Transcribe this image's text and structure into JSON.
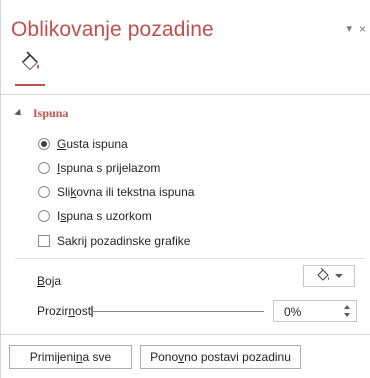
{
  "pane": {
    "title": "Oblikovanje pozadine",
    "dropdown_glyph": "▾",
    "close_glyph": "×",
    "tab_icon": "fill-bucket-icon"
  },
  "fill_section": {
    "label": "Ispuna",
    "options": [
      {
        "pre": "",
        "u": "G",
        "post": "usta ispuna",
        "checked": true
      },
      {
        "pre": "",
        "u": "I",
        "post": "spuna s prijelazom",
        "checked": false
      },
      {
        "pre": "Sli",
        "u": "k",
        "post": "ovna ili tekstna ispuna",
        "checked": false
      },
      {
        "pre": "I",
        "u": "s",
        "post": "puna s uzorkom",
        "checked": false
      }
    ],
    "hide_graphics": {
      "pre": "Sakrij pozadinske ",
      "u": "g",
      "post": "rafike",
      "checked": false
    },
    "color": {
      "pre": "",
      "u": "B",
      "post": "oja",
      "icon": "paint-bucket-icon",
      "value": "#ffffff"
    },
    "transparency": {
      "pre": "Prozir",
      "u": "n",
      "post": "ost",
      "value": "0%",
      "level": 0
    }
  },
  "buttons": {
    "apply_all": {
      "pre": "Primijeni ",
      "u": "n",
      "post": "a sve"
    },
    "reset": {
      "pre": "Pono",
      "u": "v",
      "post": "no postavi pozadinu"
    }
  },
  "colors": {
    "accent": "#c0504d",
    "text": "#262626",
    "border": "#adadad"
  }
}
